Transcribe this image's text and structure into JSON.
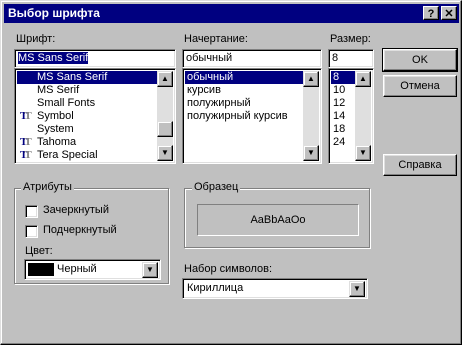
{
  "window": {
    "title": "Выбор шрифта",
    "help_glyph": "?",
    "close_glyph": "✕"
  },
  "font": {
    "label": "Шрифт:",
    "value": "MS Sans Serif",
    "items": [
      {
        "name": "MS Sans Serif",
        "icon": "none",
        "selected": true
      },
      {
        "name": "MS Serif",
        "icon": "none"
      },
      {
        "name": "Small Fonts",
        "icon": "none"
      },
      {
        "name": "Symbol",
        "icon": "truetype-icon"
      },
      {
        "name": "System",
        "icon": "none"
      },
      {
        "name": "Tahoma",
        "icon": "truetype-icon"
      },
      {
        "name": "Tera Special",
        "icon": "truetype-icon"
      }
    ]
  },
  "style": {
    "label": "Начертание:",
    "value": "обычный",
    "items": [
      "обычный",
      "курсив",
      "полужирный",
      "полужирный курсив"
    ]
  },
  "size": {
    "label": "Размер:",
    "value": "8",
    "items": [
      "8",
      "10",
      "12",
      "14",
      "18",
      "24"
    ]
  },
  "buttons": {
    "ok": "OK",
    "cancel": "Отмена",
    "help": "Справка"
  },
  "effects": {
    "label": "Атрибуты",
    "strikeout": "Зачеркнутый",
    "underline": "Подчеркнутый",
    "color_label": "Цвет:",
    "color_value": "Черный",
    "color_swatch": "#000000"
  },
  "sample": {
    "label": "Образец",
    "text": "AaBbAaOo"
  },
  "charset": {
    "label": "Набор символов:",
    "value": "Кириллица"
  },
  "colors": {
    "titlebar": "#000080",
    "selection": "#000080",
    "face": "#c0c0c0"
  }
}
